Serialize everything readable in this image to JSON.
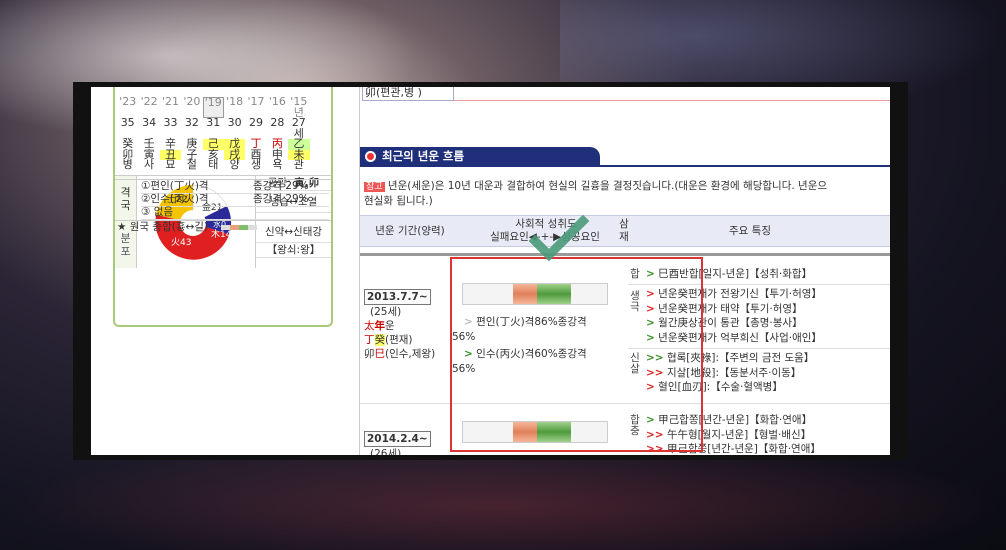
{
  "ganji": {
    "years": [
      "'23",
      "'22",
      "'21",
      "'20",
      "'19",
      "'18",
      "'17",
      "'16",
      "'15년"
    ],
    "ages": [
      "35",
      "34",
      "33",
      "32",
      "31",
      "30",
      "29",
      "28",
      "27세"
    ],
    "stems": [
      "癸",
      "壬",
      "辛",
      "庚",
      "己",
      "戊",
      "丁",
      "丙",
      "乙"
    ],
    "branches": [
      "卯",
      "寅",
      "丑",
      "子",
      "亥",
      "戌",
      "酉",
      "申",
      "未"
    ],
    "stages": [
      "병",
      "사",
      "묘",
      "절",
      "태",
      "양",
      "생",
      "욕",
      "관"
    ]
  },
  "elements": {
    "side_label": [
      "오",
      "행",
      "분",
      "포"
    ],
    "fire": "火43",
    "earth": "土22",
    "metal": "金21",
    "water": "水0",
    "wood": "木14",
    "fire_color": "#e02020",
    "earth_color": "#f5c400",
    "metal_color": "#ffffff",
    "water_color": "#2a2a9a",
    "wood_color": "#2a2a9a",
    "gongmang_label": "공망:",
    "gongmang_value": "寅,卯",
    "relation1": "냉습↔조열",
    "relation2": "신약↔신태강",
    "relation3": "【왕쇠:왕】"
  },
  "gyeok": {
    "side_label": [
      "격",
      "국"
    ],
    "rows": [
      {
        "name": "①편인(丁火)격",
        "value": "종강격 29%"
      },
      {
        "name": "②인수(丙火)격",
        "value": "종강격 29%"
      },
      {
        "name": "③ 없음",
        "value": ""
      }
    ],
    "total": "★ 원국 종합(흉↔길)"
  },
  "prev": "卯(편관,병 )",
  "section_title": "최근의 년운 흐름",
  "desc": {
    "tag": "참고",
    "line1": "년운(세운)은 10년 대운과 결합하여 현실의 길흉을 결정짓습니다.(대운은 환경에 해당합니다. 년운으",
    "line2": "현실화 됩니다.)"
  },
  "table_head": {
    "period": "년운 기간(양력)",
    "social_top": "사회적 성취도",
    "social_bottom": "실패요인◀-+-▶성공요인",
    "samjae_top": "삼",
    "samjae_bottom": "재",
    "features": "주요 특징"
  },
  "periods": [
    {
      "date": "2013.7.7~",
      "age": "(25세)",
      "line1_a": "太",
      "line1_b": "年",
      "line1_c": "운",
      "line2_a": "丁",
      "line2_b": "癸",
      "line2_c": "(편재)",
      "line3_a": "卯",
      "line3_b": "巳",
      "line3_c": "(인수,제왕)",
      "factor1": "편인(丁火)격86%종강격",
      "factor1_pct": "56%",
      "factor2": "인수(丙火)격60%종강격",
      "factor2_pct": "56%"
    },
    {
      "date": "2014.2.4~",
      "age": "(26세)"
    }
  ],
  "features": {
    "hap_label": "합",
    "hap": [
      "巳酉반합[일지-년운]【성취·화합】"
    ],
    "saengguk_label": "생극",
    "saengguk": [
      "년운癸편재가 전왕기신【투기·허영】",
      "년운癸편재가 태약【투기·허영】",
      "월간庚상관이 통관【총명·봉사】",
      "년운癸편재가 억부희신【사업·애인】"
    ],
    "sinsal_label": "신살",
    "sinsal": [
      "협록[夾祿]:【주변의 금전 도움】",
      "지살[地殺]:【동분서주·이동】",
      "혈인[血刃]:【수술·혈액병】"
    ],
    "hapchung_label": "합충",
    "hapchung": [
      "甲己합쫑[년간-년운]【화합·연애】",
      "午午형[월지-년운]【형벌·배신】",
      "甲己합쫑[년간-년운]【화합·연애】"
    ]
  }
}
